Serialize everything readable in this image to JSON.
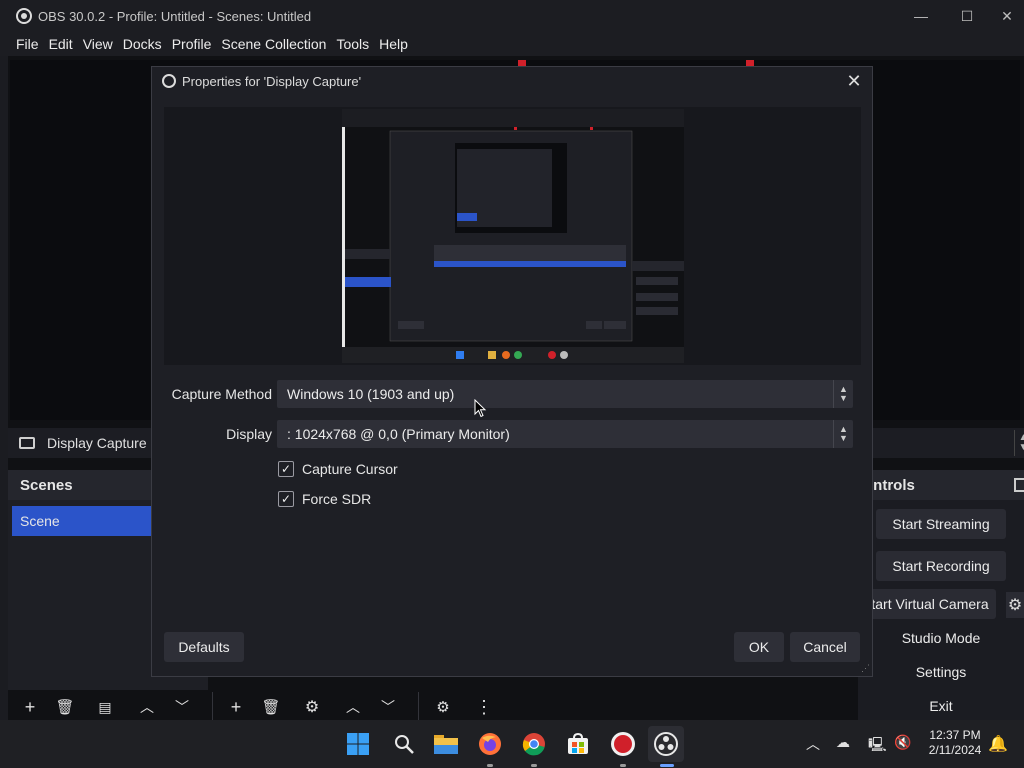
{
  "window": {
    "title": "OBS 30.0.2 - Profile: Untitled - Scenes: Untitled",
    "minimize_glyph": "—",
    "maximize_glyph": "☐",
    "close_glyph": "✕"
  },
  "menu": [
    "File",
    "Edit",
    "View",
    "Docks",
    "Profile",
    "Scene Collection",
    "Tools",
    "Help"
  ],
  "source_bar": {
    "label": "Display Capture"
  },
  "scenes": {
    "header": "Scenes",
    "items": [
      "Scene"
    ]
  },
  "controls": {
    "header": "Controls",
    "header_visible": "ontrols",
    "buttons": [
      "Start Streaming",
      "Start Recording",
      "Start Virtual Camera",
      "Studio Mode",
      "Settings",
      "Exit"
    ],
    "virtual_camera_visible": "tart Virtual Camera"
  },
  "dialog": {
    "title": "Properties for 'Display Capture'",
    "close_glyph": "✕",
    "capture_method": {
      "label": "Capture Method",
      "value": "Windows 10 (1903 and up)"
    },
    "display": {
      "label": "Display",
      "value": ": 1024x768 @ 0,0 (Primary Monitor)"
    },
    "capture_cursor": {
      "label": "Capture Cursor",
      "checked": true
    },
    "force_sdr": {
      "label": "Force SDR",
      "checked": true
    },
    "defaults_label": "Defaults",
    "ok_label": "OK",
    "cancel_label": "Cancel"
  },
  "taskbar": {
    "clock_time": "12:37 PM",
    "clock_date": "2/11/2024",
    "apps": [
      "start-icon",
      "search-icon",
      "file-explorer-icon",
      "firefox-icon",
      "chrome-icon",
      "microsoft-store-icon",
      "recording-app-icon",
      "obs-icon"
    ]
  },
  "colors": {
    "accent": "#2b54c9",
    "background": "#101114",
    "panel": "#1e1f25",
    "record_red": "#d0202a"
  }
}
